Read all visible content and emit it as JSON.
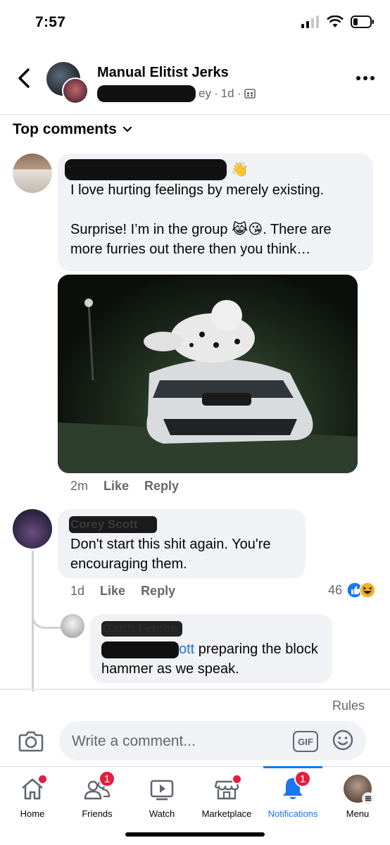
{
  "status_bar": {
    "time": "7:57"
  },
  "header": {
    "group_name": "Manual Elitist Jerks",
    "poster_visible": "ey",
    "time": "1d"
  },
  "section_title": "Top comments",
  "comments": [
    {
      "text": "I love hurting feelings by merely existing.\n\nSurprise! I’m in the group 😹😘. There are more furries out there then you think…",
      "time": "2m",
      "like": "Like",
      "reply": "Reply"
    },
    {
      "author": "Corey Scott",
      "text": "Don't start this shit again. You're encouraging them.",
      "time": "1d",
      "like": "Like",
      "reply": "Reply",
      "reaction_count": "46"
    },
    {
      "author": "Garth Fenton",
      "mention_visible": "ott",
      "text": " preparing the block hammer as we speak."
    }
  ],
  "composer": {
    "rules_link": "Rules",
    "placeholder": "Write a comment...",
    "gif_label": "GIF"
  },
  "tabs": [
    {
      "label": "Home",
      "icon": "home-icon",
      "indicator": "dot"
    },
    {
      "label": "Friends",
      "icon": "friends-icon",
      "badge": "1"
    },
    {
      "label": "Watch",
      "icon": "watch-icon"
    },
    {
      "label": "Marketplace",
      "icon": "marketplace-icon",
      "indicator": "dot"
    },
    {
      "label": "Notifications",
      "icon": "bell-icon",
      "badge": "1",
      "active": true
    },
    {
      "label": "Menu",
      "icon": "menu-avatar-icon"
    }
  ],
  "colors": {
    "accent": "#1877f2",
    "badge": "#e41e3f",
    "bubble": "#f0f2f5",
    "secondary_text": "#65676b"
  }
}
